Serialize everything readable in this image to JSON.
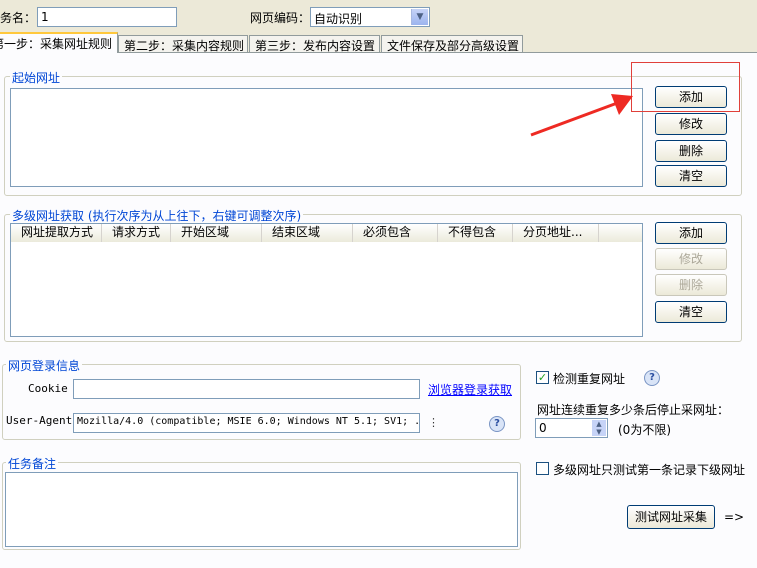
{
  "task_name": {
    "label": "务名：",
    "value": "1"
  },
  "encoding": {
    "label": "网页编码：",
    "value": "自动识别"
  },
  "tabs": [
    {
      "label": "第一步：采集网址规则"
    },
    {
      "label": "第二步：采集内容规则"
    },
    {
      "label": "第三步：发布内容设置"
    },
    {
      "label": "文件保存及部分高级设置"
    }
  ],
  "start_url": {
    "title": "起始网址",
    "buttons": {
      "add": "添加",
      "edit": "修改",
      "delete": "删除",
      "clear": "清空"
    }
  },
  "multi_level": {
    "title": "多级网址获取 (执行次序为从上往下，右键可调整次序)",
    "columns": [
      "网址提取方式",
      "请求方式",
      "开始区域",
      "结束区域",
      "必须包含",
      "不得包含",
      "分页地址..."
    ],
    "buttons": {
      "add": "添加",
      "edit": "修改",
      "delete": "删除",
      "clear": "清空"
    }
  },
  "login": {
    "title": "网页登录信息",
    "cookie_label": "Cookie",
    "cookie_value": "",
    "browser_login_link": "浏览器登录获取",
    "ua_label": "User-Agent",
    "ua_value": "Mozilla/4.0 (compatible; MSIE 6.0; Windows NT 5.1; SV1; ."
  },
  "options": {
    "detect_duplicate_label": "检测重复网址",
    "detect_duplicate_checked": true,
    "stop_after_label": "网址连续重复多少条后停止采网址：",
    "stop_after_value": "0",
    "stop_after_hint": "(0为不限)",
    "test_first_only_label": "多级网址只测试第一条记录下级网址",
    "test_first_only_checked": false
  },
  "notes": {
    "title": "任务备注",
    "value": ""
  },
  "test_button": {
    "label": "测试网址采集",
    "arrow": "=>"
  },
  "icons": {
    "help": "help-icon",
    "dropdown": "chevron-down-icon",
    "pointer": "red-arrow-annotation"
  }
}
